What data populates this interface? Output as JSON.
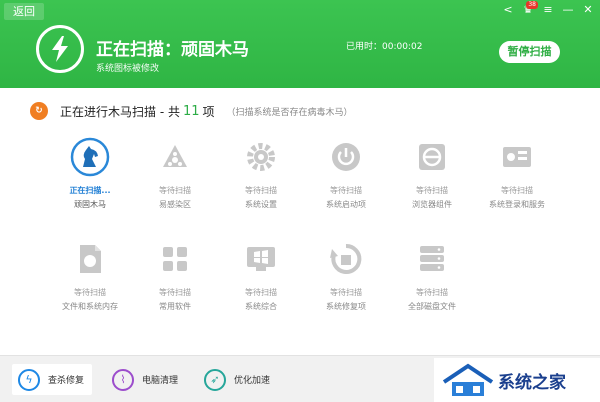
{
  "header": {
    "back_label": "返回",
    "scan_title": "正在扫描：顽固木马",
    "scan_sub": "系统图标被修改",
    "elapsed": "已用时：00:00:02",
    "pause_label": "暂停扫描",
    "notification_count": "38",
    "controls": [
      "share-icon",
      "shirt-icon",
      "menu-icon",
      "minimize-icon",
      "close-icon"
    ]
  },
  "progress": {
    "prefix": "正在进行木马扫描 - 共",
    "count": "11",
    "suffix": "项",
    "hint": "（扫描系统是否存在病毒木马）"
  },
  "items": [
    {
      "status": "正在扫描...",
      "name": "顽固木马",
      "icon": "horse-icon",
      "active": true
    },
    {
      "status": "等待扫描",
      "name": "易感染区",
      "icon": "biohazard-icon",
      "active": false
    },
    {
      "status": "等待扫描",
      "name": "系统设置",
      "icon": "gear-icon",
      "active": false
    },
    {
      "status": "等待扫描",
      "name": "系统启动项",
      "icon": "power-icon",
      "active": false
    },
    {
      "status": "等待扫描",
      "name": "浏览器组件",
      "icon": "browser-icon",
      "active": false
    },
    {
      "status": "等待扫描",
      "name": "系统登录和服务",
      "icon": "login-service-icon",
      "active": false
    },
    {
      "status": "等待扫描",
      "name": "文件和系统内存",
      "icon": "file-memory-icon",
      "active": false
    },
    {
      "status": "等待扫描",
      "name": "常用软件",
      "icon": "software-icon",
      "active": false
    },
    {
      "status": "等待扫描",
      "name": "系统综合",
      "icon": "windows-icon",
      "active": false
    },
    {
      "status": "等待扫描",
      "name": "系统修复项",
      "icon": "repair-icon",
      "active": false
    },
    {
      "status": "等待扫描",
      "name": "全部磁盘文件",
      "icon": "disk-icon",
      "active": false
    }
  ],
  "bottom_tabs": [
    {
      "label": "查杀修复",
      "icon": "bolt-icon",
      "color": "#1e88e5",
      "selected": true
    },
    {
      "label": "电脑清理",
      "icon": "broom-icon",
      "color": "#9c4dcc",
      "selected": false
    },
    {
      "label": "优化加速",
      "icon": "rocket-icon",
      "color": "#26a69a",
      "selected": false
    }
  ],
  "watermark": {
    "text": "系统之家"
  },
  "colors": {
    "header_green": "#2fb544",
    "accent_green": "#2cac46",
    "active_blue": "#1f7ed4",
    "orange": "#f07e22",
    "icon_gray": "#c8c8c8"
  }
}
